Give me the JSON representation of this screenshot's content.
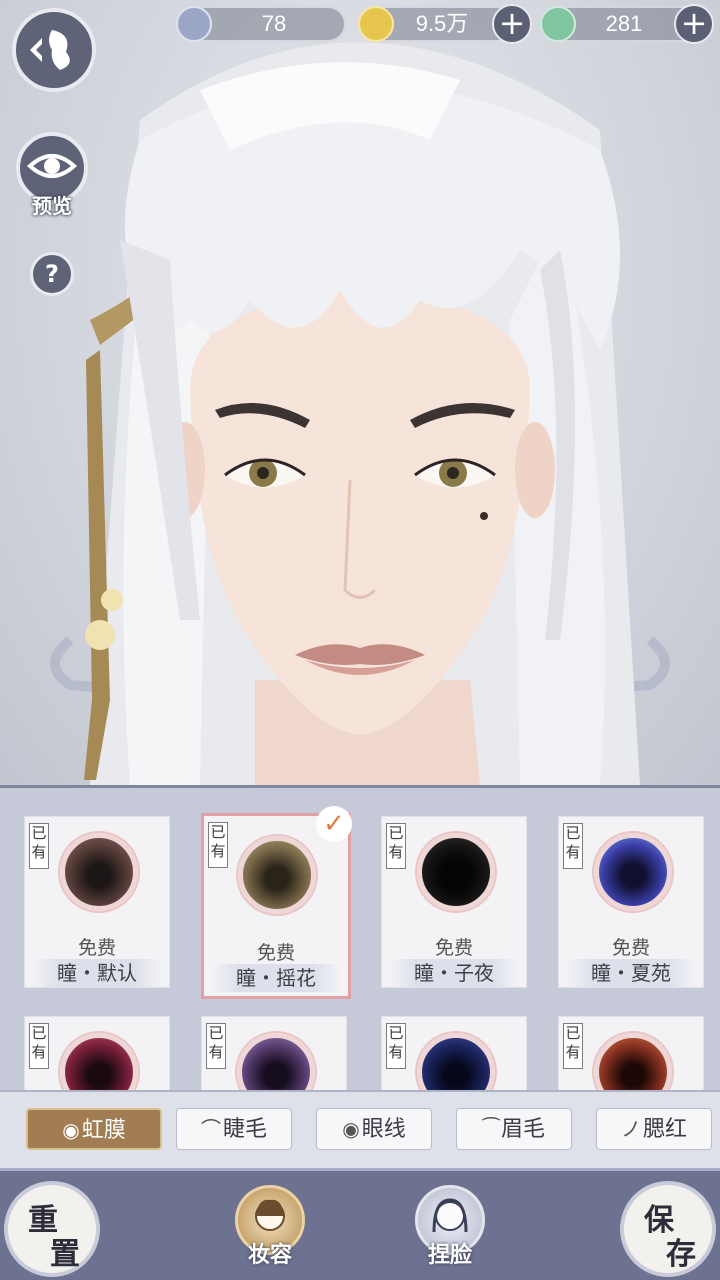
{
  "currency": [
    {
      "icon": "silver-feather-coin-icon",
      "value": "78",
      "has_plus": false
    },
    {
      "icon": "gold-coin-icon",
      "value": "9.5万",
      "has_plus": true
    },
    {
      "icon": "jade-token-icon",
      "value": "281",
      "has_plus": true
    }
  ],
  "sidebar": {
    "preview_label": "预览",
    "help_label": "?"
  },
  "items": [
    {
      "owned": "已有",
      "price": "免费",
      "name": "瞳・默认",
      "color": "#5a3f3a",
      "selected": false
    },
    {
      "owned": "已有",
      "price": "免费",
      "name": "瞳・摇花",
      "color": "#7b6a4a",
      "selected": true
    },
    {
      "owned": "已有",
      "price": "免费",
      "name": "瞳・子夜",
      "color": "#151515",
      "selected": false
    },
    {
      "owned": "已有",
      "price": "免费",
      "name": "瞳・夏苑",
      "color": "#3b3fa8",
      "selected": false
    },
    {
      "owned": "已有",
      "color": "#7a1f3a"
    },
    {
      "owned": "已有",
      "color": "#5a3f72"
    },
    {
      "owned": "已有",
      "color": "#1d2560"
    },
    {
      "owned": "已有",
      "color": "#8a3322"
    }
  ],
  "tabs": [
    {
      "icon": "iris-icon",
      "glyph": "◉",
      "label": "虹膜",
      "active": true
    },
    {
      "icon": "eyelash-icon",
      "glyph": "⌒",
      "label": "睫毛",
      "active": false
    },
    {
      "icon": "eyeliner-icon",
      "glyph": "◉",
      "label": "眼线",
      "active": false
    },
    {
      "icon": "eyebrow-icon",
      "glyph": "⁀",
      "label": "眉毛",
      "active": false
    },
    {
      "icon": "blush-icon",
      "glyph": "ノ",
      "label": "腮红",
      "active": false
    }
  ],
  "bottom": {
    "reset_top": "重",
    "reset_bottom": "置",
    "makeup_label": "妆容",
    "face_label": "捏脸",
    "save_top": "保",
    "save_bottom": "存"
  },
  "colors": {
    "accent_brown": "#a27c52",
    "panel_bg": "#c6cad8",
    "bottom_bar": "#6d7290",
    "check_orange": "#e07b3c"
  }
}
